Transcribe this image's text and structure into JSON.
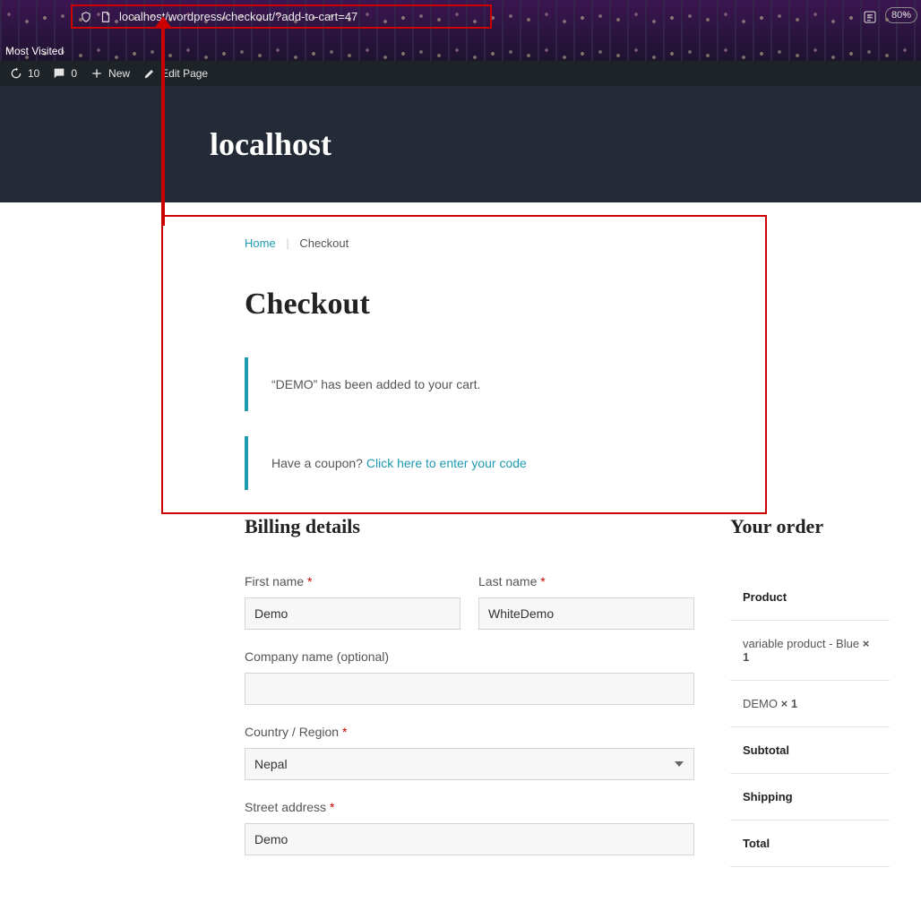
{
  "browser": {
    "url": "localhost/wordpress/checkout/?add-to-cart=47",
    "zoom": "80%",
    "most_visited": "Most Visited"
  },
  "admin_bar": {
    "updates_count": "10",
    "comments_count": "0",
    "new_label": "New",
    "edit_label": "Edit Page"
  },
  "site": {
    "title": "localhost"
  },
  "breadcrumb": {
    "home": "Home",
    "current": "Checkout"
  },
  "page": {
    "title": "Checkout"
  },
  "notices": {
    "added": "“DEMO” has been added to your cart.",
    "coupon_q": "Have a coupon? ",
    "coupon_link": "Click here to enter your code"
  },
  "billing": {
    "heading": "Billing details",
    "first_name_label": "First name ",
    "first_name_value": "Demo",
    "last_name_label": "Last name ",
    "last_name_value": "WhiteDemo",
    "company_label": "Company name (optional)",
    "company_value": "",
    "country_label": "Country / Region ",
    "country_value": "Nepal",
    "street_label": "Street address ",
    "street_value": "Demo"
  },
  "order": {
    "heading": "Your order",
    "product_header": "Product",
    "items": [
      {
        "name": "variable product - Blue ",
        "qty": "× 1"
      },
      {
        "name": "DEMO ",
        "qty": "× 1"
      }
    ],
    "subtotal_label": "Subtotal",
    "shipping_label": "Shipping",
    "total_label": "Total"
  }
}
